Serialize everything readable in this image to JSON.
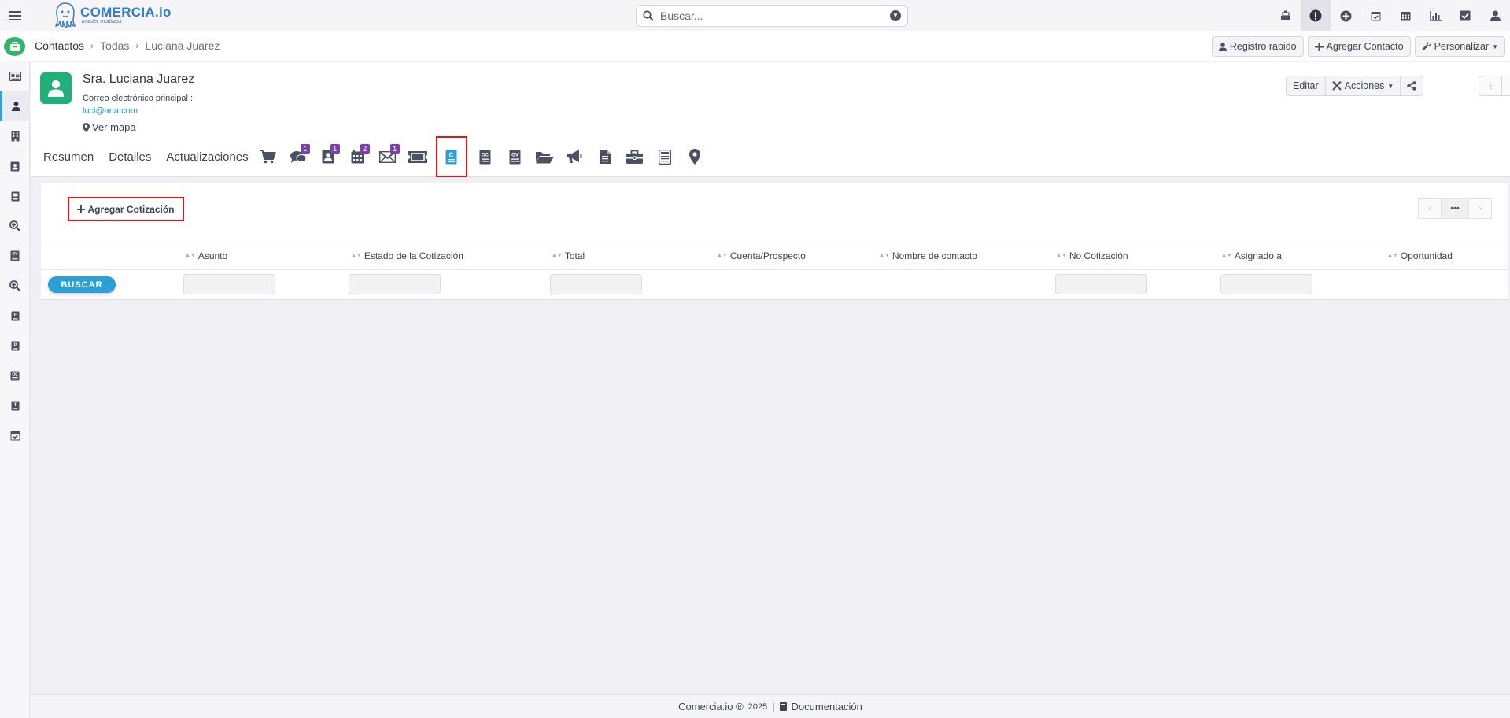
{
  "app": {
    "brand": "COMERCIA.io",
    "tagline": "master multitask"
  },
  "search": {
    "placeholder": "Buscar..."
  },
  "topbar_icons": [
    "cash-register-icon",
    "alert-icon",
    "plus-circle-icon",
    "calendar-check-icon",
    "calendar-icon",
    "chart-icon",
    "checkbox-icon",
    "user-icon"
  ],
  "breadcrumb": {
    "module": "Contactos",
    "list": "Todas",
    "record": "Luciana Juarez"
  },
  "subbar_actions": {
    "quick_register": "Registro rapido",
    "add_contact": "Agregar Contacto",
    "customize": "Personalizar"
  },
  "sidebar_icons": [
    "id-card-icon",
    "user-icon",
    "building-icon",
    "contact-card-icon",
    "book-icon",
    "search-plus-icon",
    "ov-icon",
    "search-plus-icon",
    "book-f-icon",
    "book-p-icon",
    "oc-icon",
    "book-t-icon",
    "calendar-check-icon"
  ],
  "contact": {
    "name": "Sra. Luciana Juarez",
    "email_label": "Correo electrónico principal :",
    "email": "luci@ana.com",
    "map_link": "Ver mapa"
  },
  "header_actions": {
    "edit": "Editar",
    "actions": "Acciones"
  },
  "tabs": {
    "summary": "Resumen",
    "details": "Detalles",
    "updates": "Actualizaciones"
  },
  "tab_icons": [
    {
      "name": "cart-icon",
      "badge": ""
    },
    {
      "name": "comments-icon",
      "badge": "1"
    },
    {
      "name": "contact-book-icon",
      "badge": "1"
    },
    {
      "name": "calendar-icon",
      "badge": "2"
    },
    {
      "name": "envelope-icon",
      "badge": "1"
    },
    {
      "name": "ticket-icon",
      "badge": ""
    },
    {
      "name": "quote-c-icon",
      "badge": ""
    },
    {
      "name": "oc-doc-icon",
      "badge": ""
    },
    {
      "name": "ov-doc-icon",
      "badge": ""
    },
    {
      "name": "folder-open-icon",
      "badge": ""
    },
    {
      "name": "bullhorn-icon",
      "badge": ""
    },
    {
      "name": "file-icon",
      "badge": ""
    },
    {
      "name": "briefcase-icon",
      "badge": ""
    },
    {
      "name": "ledger-icon",
      "badge": ""
    },
    {
      "name": "map-marker-icon",
      "badge": ""
    }
  ],
  "quotes": {
    "add_button": "Agregar Cotización",
    "pager_more": "•••",
    "columns": [
      "Asunto",
      "Estado de la Cotización",
      "Total",
      "Cuenta/Prospecto",
      "Nombre de contacto",
      "No Cotización",
      "Asignado a",
      "Oportunidad"
    ],
    "search_button": "BUSCAR"
  },
  "footer": {
    "brand": "Comercia.io ®",
    "year": "2025",
    "separator": "|",
    "docs": "Documentación"
  },
  "colors": {
    "accent": "#2a9fd8",
    "brand_green": "#20b07a",
    "badge_purple": "#7b3fb0",
    "highlight_red": "#e01818"
  }
}
